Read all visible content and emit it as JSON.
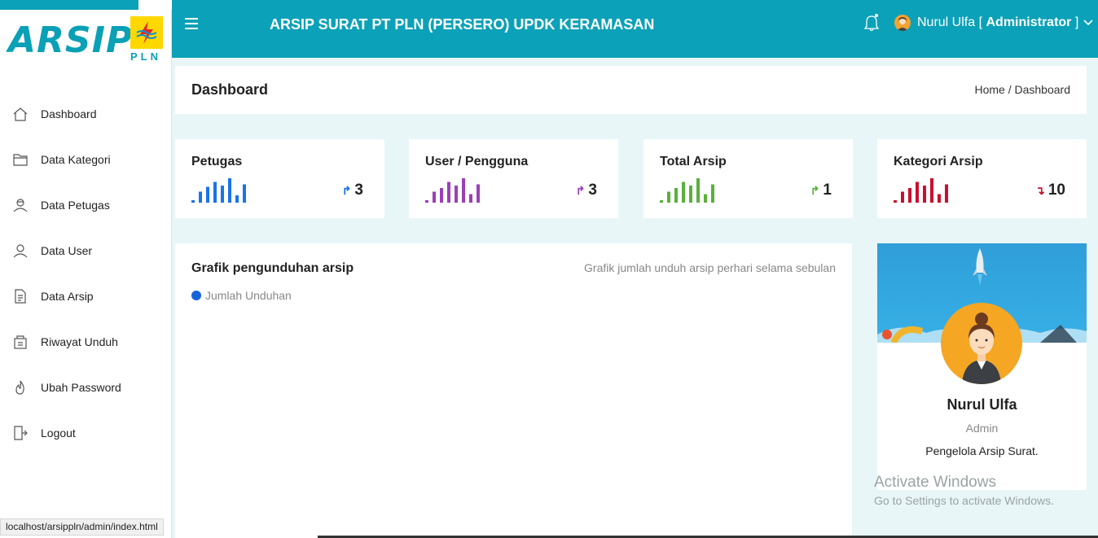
{
  "brand": {
    "logo_text": "ARSIP",
    "company_logo_text": "PLN",
    "accent_color": "#0ba1b8"
  },
  "sidebar": {
    "items": [
      {
        "label": "Dashboard",
        "icon": "home-icon"
      },
      {
        "label": "Data Kategori",
        "icon": "folder-icon"
      },
      {
        "label": "Data Petugas",
        "icon": "user-officer-icon"
      },
      {
        "label": "Data User",
        "icon": "user-icon"
      },
      {
        "label": "Data Arsip",
        "icon": "document-icon"
      },
      {
        "label": "Riwayat Unduh",
        "icon": "history-icon"
      },
      {
        "label": "Ubah Password",
        "icon": "flame-icon"
      },
      {
        "label": "Logout",
        "icon": "logout-icon"
      }
    ]
  },
  "topbar": {
    "title": "ARSIP SURAT PT PLN (PERSERO) UPDK KERAMASAN",
    "user_name": "Nurul Ulfa",
    "user_role": "Administrator",
    "bracket_open": "[",
    "bracket_close": "]"
  },
  "page": {
    "title": "Dashboard",
    "breadcrumb_home": "Home",
    "breadcrumb_separator": "/",
    "breadcrumb_current": "Dashboard"
  },
  "stats": [
    {
      "title": "Petugas",
      "value": "3",
      "trend": "up",
      "color": "#1a73e8",
      "bars": [
        0.1,
        0.45,
        0.65,
        0.85,
        0.7,
        1.0,
        0.3,
        0.75
      ]
    },
    {
      "title": "User / Pengguna",
      "value": "3",
      "trend": "up",
      "color": "#9c3fb8",
      "bars": [
        0.1,
        0.45,
        0.6,
        0.85,
        0.7,
        1.0,
        0.35,
        0.75
      ]
    },
    {
      "title": "Total Arsip",
      "value": "1",
      "trend": "up",
      "color": "#5ab03b",
      "bars": [
        0.1,
        0.45,
        0.6,
        0.85,
        0.7,
        1.0,
        0.35,
        0.75
      ]
    },
    {
      "title": "Kategori Arsip",
      "value": "10",
      "trend": "down",
      "color": "#c8102e",
      "bars": [
        0.1,
        0.45,
        0.6,
        0.85,
        0.7,
        1.0,
        0.35,
        0.75
      ]
    }
  ],
  "chart": {
    "title": "Grafik pengunduhan arsip",
    "subtitle": "Grafik jumlah unduh arsip perhari selama sebulan",
    "legend": "Jumlah Unduhan",
    "legend_color": "#1565d8"
  },
  "profile": {
    "name": "Nurul Ulfa",
    "role": "Admin",
    "description": "Pengelola Arsip Surat."
  },
  "watermark": {
    "title": "Activate Windows",
    "subtitle": "Go to Settings to activate Windows."
  },
  "statusbar": {
    "url": "localhost/arsippln/admin/index.html"
  }
}
